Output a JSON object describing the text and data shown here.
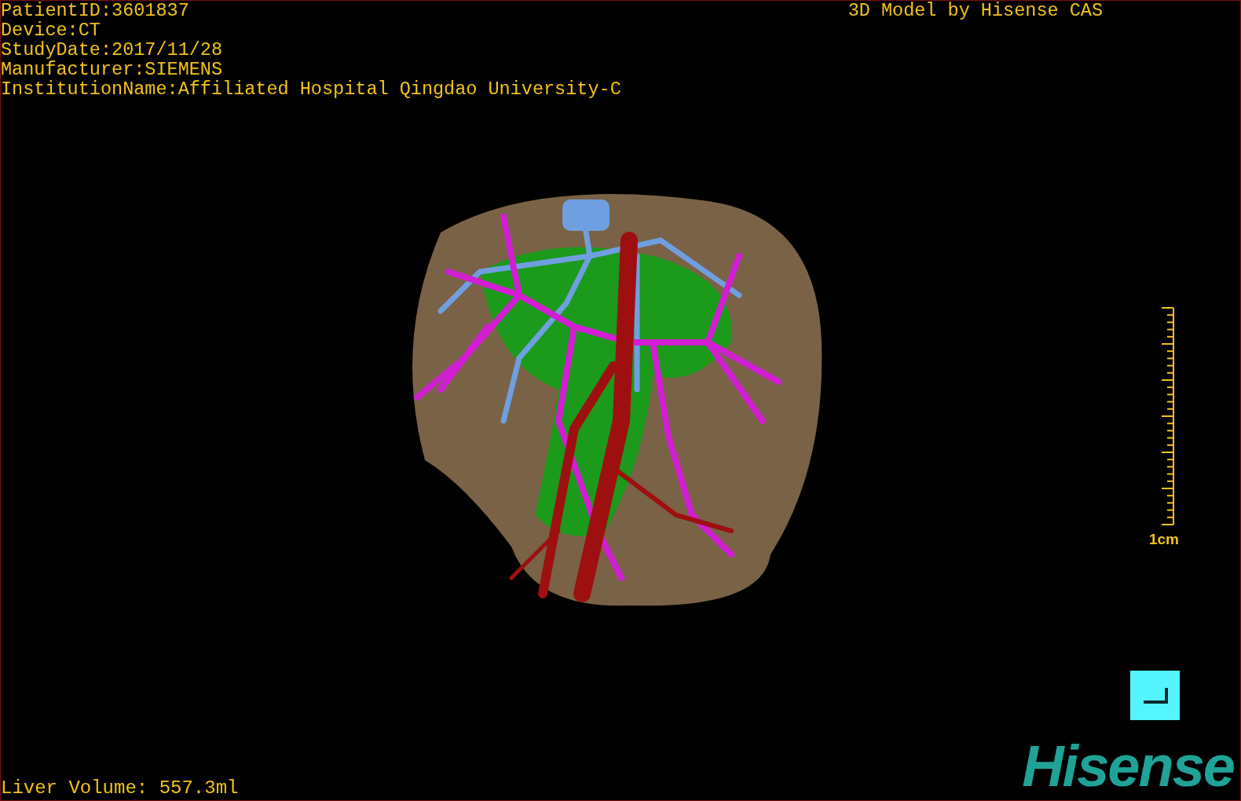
{
  "info_lines": [
    "PatientID:3601837",
    "Device:CT",
    "StudyDate:2017/11/28",
    "Manufacturer:SIEMENS",
    "InstitutionName:Affiliated Hospital Qingdao University-C"
  ],
  "credit": "3D Model by Hisense CAS",
  "scale_label": "1cm",
  "volume": "Liver Volume: 557.3ml",
  "logo": "Hisense"
}
